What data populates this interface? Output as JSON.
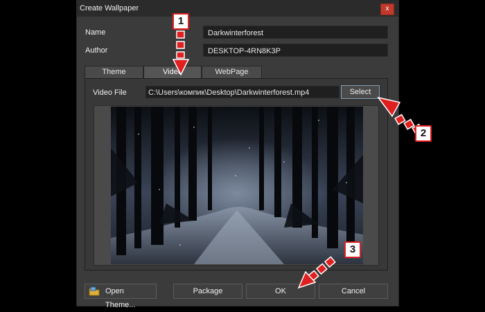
{
  "window": {
    "title": "Create Wallpaper",
    "close_label": "x"
  },
  "form": {
    "name_label": "Name",
    "name_value": "Darkwinterforest",
    "author_label": "Author",
    "author_value": "DESKTOP-4RN8K3P"
  },
  "tabs": [
    {
      "label": "Theme"
    },
    {
      "label": "Video",
      "active": true
    },
    {
      "label": "WebPage"
    }
  ],
  "video": {
    "file_label": "Video File",
    "file_path": "C:\\Users\\компик\\Desktop\\Darkwinterforest.mp4",
    "select_label": "Select"
  },
  "buttons": {
    "open_theme": "Open Theme...",
    "package": "Package",
    "ok": "OK",
    "cancel": "Cancel"
  },
  "annotations": {
    "marker1": "1",
    "marker2": "2",
    "marker3": "3",
    "marker_color": "#e02020"
  }
}
